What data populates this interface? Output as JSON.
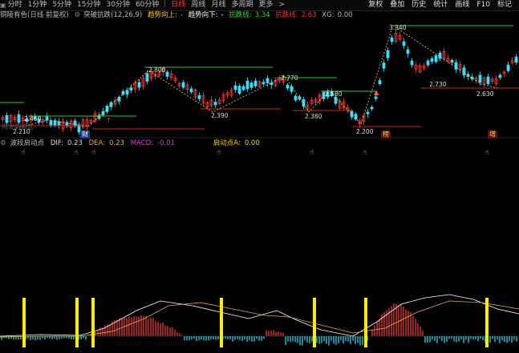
{
  "toolbar": {
    "periods": [
      {
        "label": "分时",
        "active": false
      },
      {
        "label": "1分钟",
        "active": false
      },
      {
        "label": "5分钟",
        "active": false
      },
      {
        "label": "15分钟",
        "active": false
      },
      {
        "label": "30分钟",
        "active": false
      },
      {
        "label": "60分钟",
        "active": false
      },
      {
        "label": "日线",
        "active": true
      },
      {
        "label": "周线",
        "active": false
      },
      {
        "label": "月线",
        "active": false
      },
      {
        "label": "多周期",
        "active": false
      },
      {
        "label": "更多",
        "active": false
      }
    ],
    "more_arrow": ">",
    "right": [
      "复权",
      "叠加",
      "历史",
      "统计",
      "画线",
      "F10",
      "标记"
    ]
  },
  "main_info": {
    "stock": "铜陵有色(日线 前复权)",
    "indicator": "突破抗跌(12,26,9)",
    "trend_up_label": "趋势向上:",
    "trend_up_value": "-",
    "trend_down_label": "趋势向下:",
    "trend_down_value": "-",
    "support_label": "抗跌线:",
    "support_value": "3.34",
    "resist_label": "抗跌线:",
    "resist_value": "2.63",
    "xg_label": "XG:",
    "xg_value": "0.00"
  },
  "sub_info": {
    "name": "波段启动点",
    "dif_label": "DIF:",
    "dif_value": "0.23",
    "dea_label": "DEA:",
    "dea_value": "0.23",
    "macd_label": "MACD:",
    "macd_value": "-0.01",
    "qd_label": "启动点A:",
    "qd_value": "0.00"
  },
  "price_labels": [
    "2.210",
    "2.390",
    "2.380",
    "2.200",
    "2.730",
    "2.630",
    "2.460",
    "2.800",
    "2.770",
    "2.580",
    "3.340"
  ],
  "signals": [
    "财",
    "榜",
    "增"
  ],
  "watermark": "用友的自选",
  "colors": {
    "up": "#ff3b3b",
    "down": "#33e0ff",
    "support": "#22cc33",
    "resist": "#cc2020",
    "trend": "#e8d050",
    "dif": "#ffffff",
    "dea": "#e0b040",
    "signal_bar": "#ffee00"
  }
}
